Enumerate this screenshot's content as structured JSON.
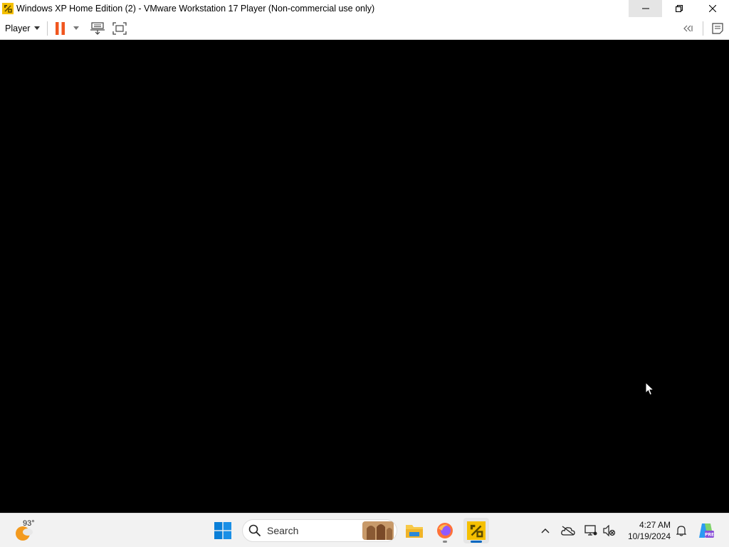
{
  "window": {
    "title": "Windows XP Home Edition (2) - VMware Workstation 17 Player (Non-commercial use only)",
    "app_icon": "vmware-icon",
    "controls": [
      "minimize-icon",
      "restore-icon",
      "close-icon"
    ]
  },
  "toolbar": {
    "player_label": "Player",
    "buttons": [
      "pause-icon",
      "dropdown-arrow-icon",
      "send-ctrl-alt-del-icon",
      "full-screen-icon"
    ],
    "right_buttons": [
      "collapse-library-icon",
      "message-log-icon"
    ],
    "accent": "#f0561f"
  },
  "taskbar": {
    "weather_temp": "93°",
    "search_label": "Search",
    "apps": [
      "file-explorer-icon",
      "firefox-icon",
      "vmware-icon"
    ],
    "time": "4:27 AM",
    "date": "10/19/2024",
    "tray": [
      "chevron-up-icon",
      "onedrive-icon",
      "network-icon",
      "volume-muted-icon",
      "notification-bell-icon",
      "copilot-icon"
    ]
  }
}
